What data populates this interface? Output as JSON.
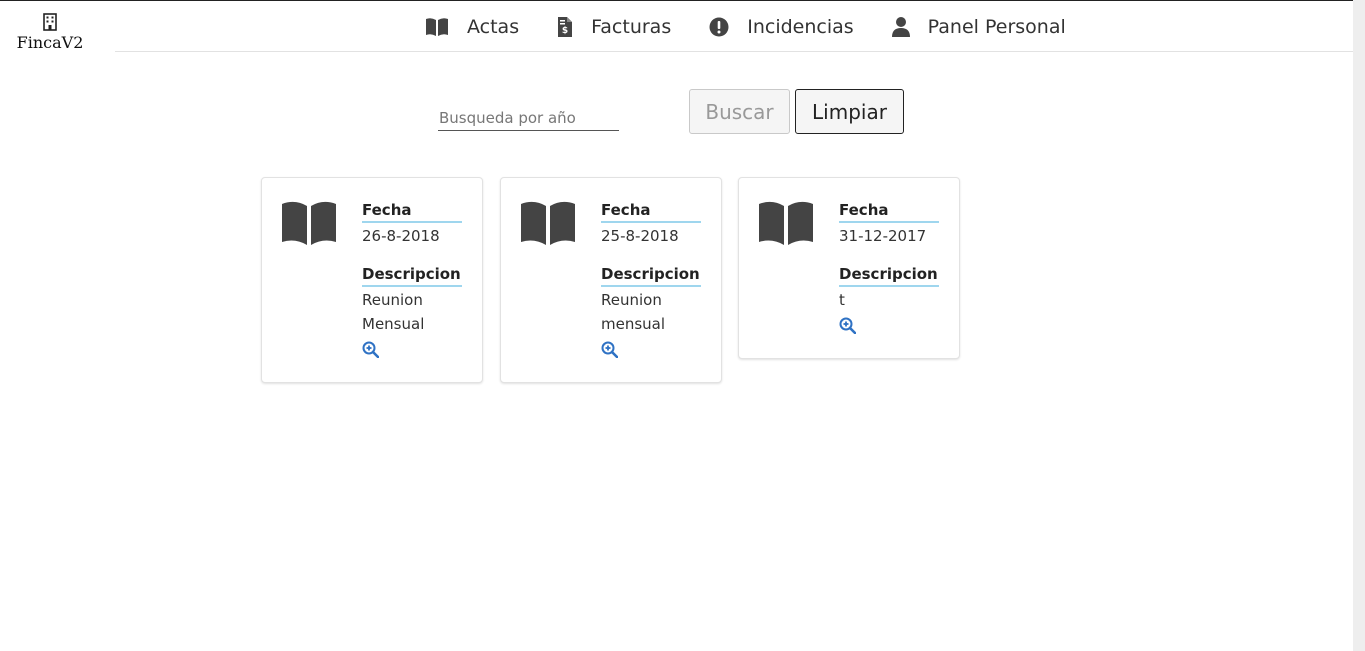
{
  "brand": {
    "icon": "building-icon",
    "name": "FincaV2"
  },
  "nav": {
    "items": [
      {
        "label": "Actas",
        "icon": "book-open-icon"
      },
      {
        "label": "Facturas",
        "icon": "file-invoice-dollar-icon"
      },
      {
        "label": "Incidencias",
        "icon": "exclamation-circle-icon"
      },
      {
        "label": "Panel Personal",
        "icon": "user-icon"
      }
    ]
  },
  "search": {
    "placeholder": "Busqueda por año",
    "value": "",
    "buscar_label": "Buscar",
    "limpiar_label": "Limpiar"
  },
  "fields": {
    "fecha": "Fecha",
    "descripcion": "Descripcion"
  },
  "actas": [
    {
      "fecha": "26-8-2018",
      "descripcion_lines": [
        "Reunion",
        "Mensual"
      ]
    },
    {
      "fecha": "25-8-2018",
      "descripcion_lines": [
        "Reunion",
        "mensual"
      ]
    },
    {
      "fecha": "31-12-2017",
      "descripcion_lines": [
        "t"
      ]
    }
  ],
  "colors": {
    "icon_dark": "#444444",
    "accent_underline": "#9fd6ee",
    "zoom_icon": "#2f72c4"
  }
}
